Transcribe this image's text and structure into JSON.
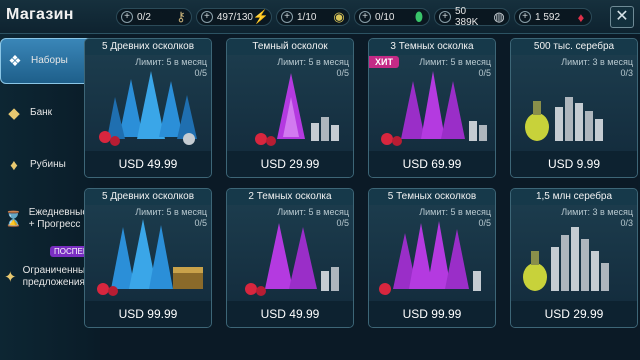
{
  "header": {
    "title": "Магазин",
    "close_glyph": "✕",
    "resources": [
      {
        "value": "0/2",
        "icon": "key-icon",
        "glyph": "⚷",
        "color": "#c9b27a"
      },
      {
        "value": "497/130",
        "icon": "energy-icon",
        "glyph": "⚡",
        "color": "#d8e25a"
      },
      {
        "value": "1/10",
        "icon": "arena-token-icon",
        "glyph": "◉",
        "color": "#d9c55a"
      },
      {
        "value": "0/10",
        "icon": "green-gem-icon",
        "glyph": "⬮",
        "color": "#39c46a"
      },
      {
        "value": "50 389K",
        "icon": "silver-icon",
        "glyph": "◍",
        "color": "#cfd6db"
      },
      {
        "value": "1 592",
        "icon": "ruby-icon",
        "glyph": "♦",
        "color": "#e0304a"
      }
    ]
  },
  "sidebar": {
    "items": [
      {
        "label": "Наборы",
        "icon": "bundle-icon",
        "glyph": "❖"
      },
      {
        "label": "Банк",
        "icon": "bank-icon",
        "glyph": "◆"
      },
      {
        "label": "Рубины",
        "icon": "rubies-icon",
        "glyph": "♦"
      },
      {
        "label": "Ежедневные + Прогресс",
        "icon": "hourglass-icon",
        "glyph": "⌛"
      },
      {
        "label": "Ограниченные предложения",
        "icon": "limited-offer-icon",
        "glyph": "✦"
      }
    ],
    "badge": "ПОСПЕШИ"
  },
  "offers": [
    {
      "title": "5 Древних осколков",
      "limit": "Лимит: 5 в месяц",
      "count": "0/5",
      "price": "USD 49.99",
      "hit": ""
    },
    {
      "title": "Темный осколок",
      "limit": "Лимит: 5 в месяц",
      "count": "0/5",
      "price": "USD 29.99",
      "hit": ""
    },
    {
      "title": "3 Темных осколка",
      "limit": "Лимит: 5 в месяц",
      "count": "0/5",
      "price": "USD 69.99",
      "hit": "ХИТ"
    },
    {
      "title": "500 тыс. серебра",
      "limit": "Лимит: 3 в месяц",
      "count": "0/3",
      "price": "USD 9.99",
      "hit": ""
    },
    {
      "title": "5 Древних осколков",
      "limit": "Лимит: 5 в месяц",
      "count": "0/5",
      "price": "USD 99.99",
      "hit": ""
    },
    {
      "title": "2 Темных осколка",
      "limit": "Лимит: 5 в месяц",
      "count": "0/5",
      "price": "USD 49.99",
      "hit": ""
    },
    {
      "title": "5 Темных осколков",
      "limit": "Лимит: 5 в месяц",
      "count": "0/5",
      "price": "USD 99.99",
      "hit": ""
    },
    {
      "title": "1,5 млн серебра",
      "limit": "Лимит: 3 в месяц",
      "count": "0/3",
      "price": "USD 29.99",
      "hit": ""
    }
  ],
  "colors": {
    "accent": "#3a86b8",
    "hit": "#c42a86",
    "ancient_shard": "#3aa6e8",
    "dark_shard": "#b43ae0",
    "silver": "#c5ccd2",
    "ruby": "#d8263e",
    "potion": "#c8d23a"
  }
}
